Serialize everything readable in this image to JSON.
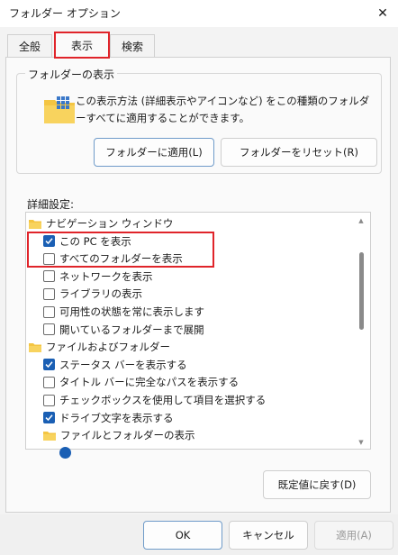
{
  "window": {
    "title": "フォルダー オプション"
  },
  "tabs": [
    {
      "label": "全般"
    },
    {
      "label": "表示"
    },
    {
      "label": "検索"
    }
  ],
  "folder_views": {
    "title": "フォルダーの表示",
    "description": "この表示方法 (詳細表示やアイコンなど) をこの種類のフォルダーすべてに適用することができます。",
    "apply_button": "フォルダーに適用(L)",
    "reset_button": "フォルダーをリセット(R)"
  },
  "advanced": {
    "label": "詳細設定:",
    "items": [
      {
        "type": "folder",
        "level": 0,
        "label": "ナビゲーション ウィンドウ"
      },
      {
        "type": "checkbox",
        "level": 1,
        "checked": true,
        "label": "この PC を表示"
      },
      {
        "type": "checkbox",
        "level": 1,
        "checked": false,
        "label": "すべてのフォルダーを表示"
      },
      {
        "type": "checkbox",
        "level": 1,
        "checked": false,
        "label": "ネットワークを表示"
      },
      {
        "type": "checkbox",
        "level": 1,
        "checked": false,
        "label": "ライブラリの表示"
      },
      {
        "type": "checkbox",
        "level": 1,
        "checked": false,
        "label": "可用性の状態を常に表示します"
      },
      {
        "type": "checkbox",
        "level": 1,
        "checked": false,
        "label": "開いているフォルダーまで展開"
      },
      {
        "type": "folder",
        "level": 0,
        "label": "ファイルおよびフォルダー"
      },
      {
        "type": "checkbox",
        "level": 1,
        "checked": true,
        "label": "ステータス バーを表示する"
      },
      {
        "type": "checkbox",
        "level": 1,
        "checked": false,
        "label": "タイトル バーに完全なパスを表示する"
      },
      {
        "type": "checkbox",
        "level": 1,
        "checked": false,
        "label": "チェックボックスを使用して項目を選択する"
      },
      {
        "type": "checkbox",
        "level": 1,
        "checked": true,
        "label": "ドライブ文字を表示する"
      },
      {
        "type": "folder",
        "level": 1,
        "label": "ファイルとフォルダーの表示"
      },
      {
        "type": "radio",
        "level": 2,
        "checked": true,
        "label": ""
      }
    ],
    "scroll_fraction": 0.2
  },
  "restore_defaults_button": "既定値に戻す(D)",
  "footer": {
    "ok": "OK",
    "cancel": "キャンセル",
    "apply": "適用(A)"
  },
  "colors": {
    "accent": "#1a5fb4",
    "highlight": "#e0242a",
    "folder": "#f4c542"
  }
}
